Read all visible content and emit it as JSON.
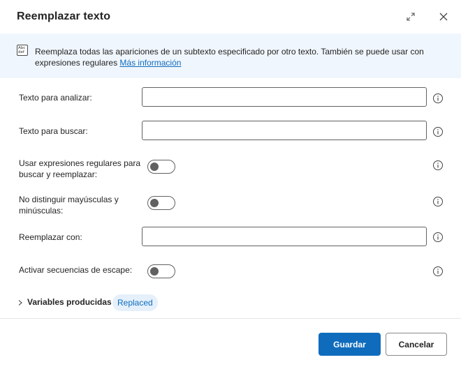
{
  "dialog": {
    "title": "Reemplazar texto",
    "expand_icon": "expand-icon",
    "close_icon": "close-icon"
  },
  "info": {
    "icon": "text-abc-def-icon",
    "icon_line1": "Abc",
    "icon_line2": "def",
    "text": "Reemplaza todas las apariciones de un subtexto especificado por otro texto. También se puede usar con expresiones regulares ",
    "link": "Más información"
  },
  "fields": {
    "text_to_parse": {
      "label": "Texto para analizar:",
      "value": "",
      "placeholder": ""
    },
    "text_to_find": {
      "label": "Texto para buscar:",
      "value": "",
      "placeholder": ""
    },
    "use_regex": {
      "label": "Usar expresiones regulares para buscar y reemplazar:",
      "on": false
    },
    "ignore_case": {
      "label": "No distinguir mayúsculas y minúsculas:",
      "on": false
    },
    "replace_with": {
      "label": "Reemplazar con:",
      "value": "",
      "placeholder": ""
    },
    "escape_sequences": {
      "label": "Activar secuencias de escape:",
      "on": false
    }
  },
  "help_icon": "info-circle-icon",
  "variables": {
    "label": "Variables producidas",
    "badge": "Replaced",
    "expanded": false
  },
  "buttons": {
    "save": "Guardar",
    "cancel": "Cancelar"
  },
  "colors": {
    "primary": "#0f6cbd",
    "banner_bg": "#f0f6fd",
    "badge_bg": "#e5f0fb"
  }
}
